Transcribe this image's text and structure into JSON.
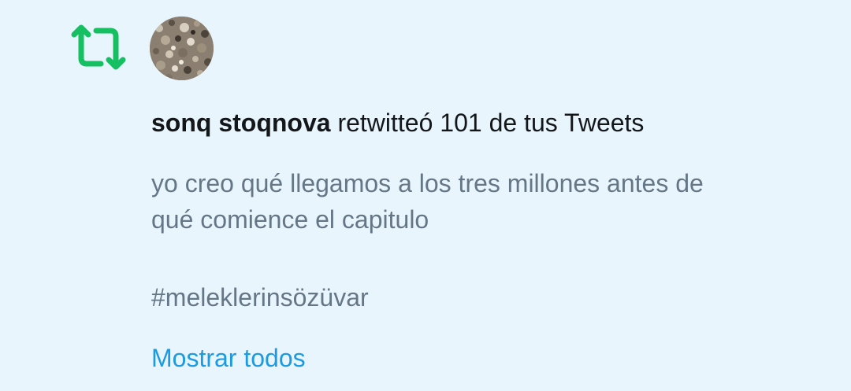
{
  "notification": {
    "icon": "retweet-icon",
    "icon_color": "#17bf63",
    "avatar": "avatar",
    "username": "sonq stoqnova",
    "action_text": " retwitteó 101 de tus Tweets",
    "tweet_line1": "yo creo qué llegamos a los tres millones antes de",
    "tweet_line2": "qué comience el capitulo",
    "hashtag": "#meleklerinsözüvar",
    "show_all_label": "Mostrar todos",
    "link_color": "#1d9ae0"
  }
}
